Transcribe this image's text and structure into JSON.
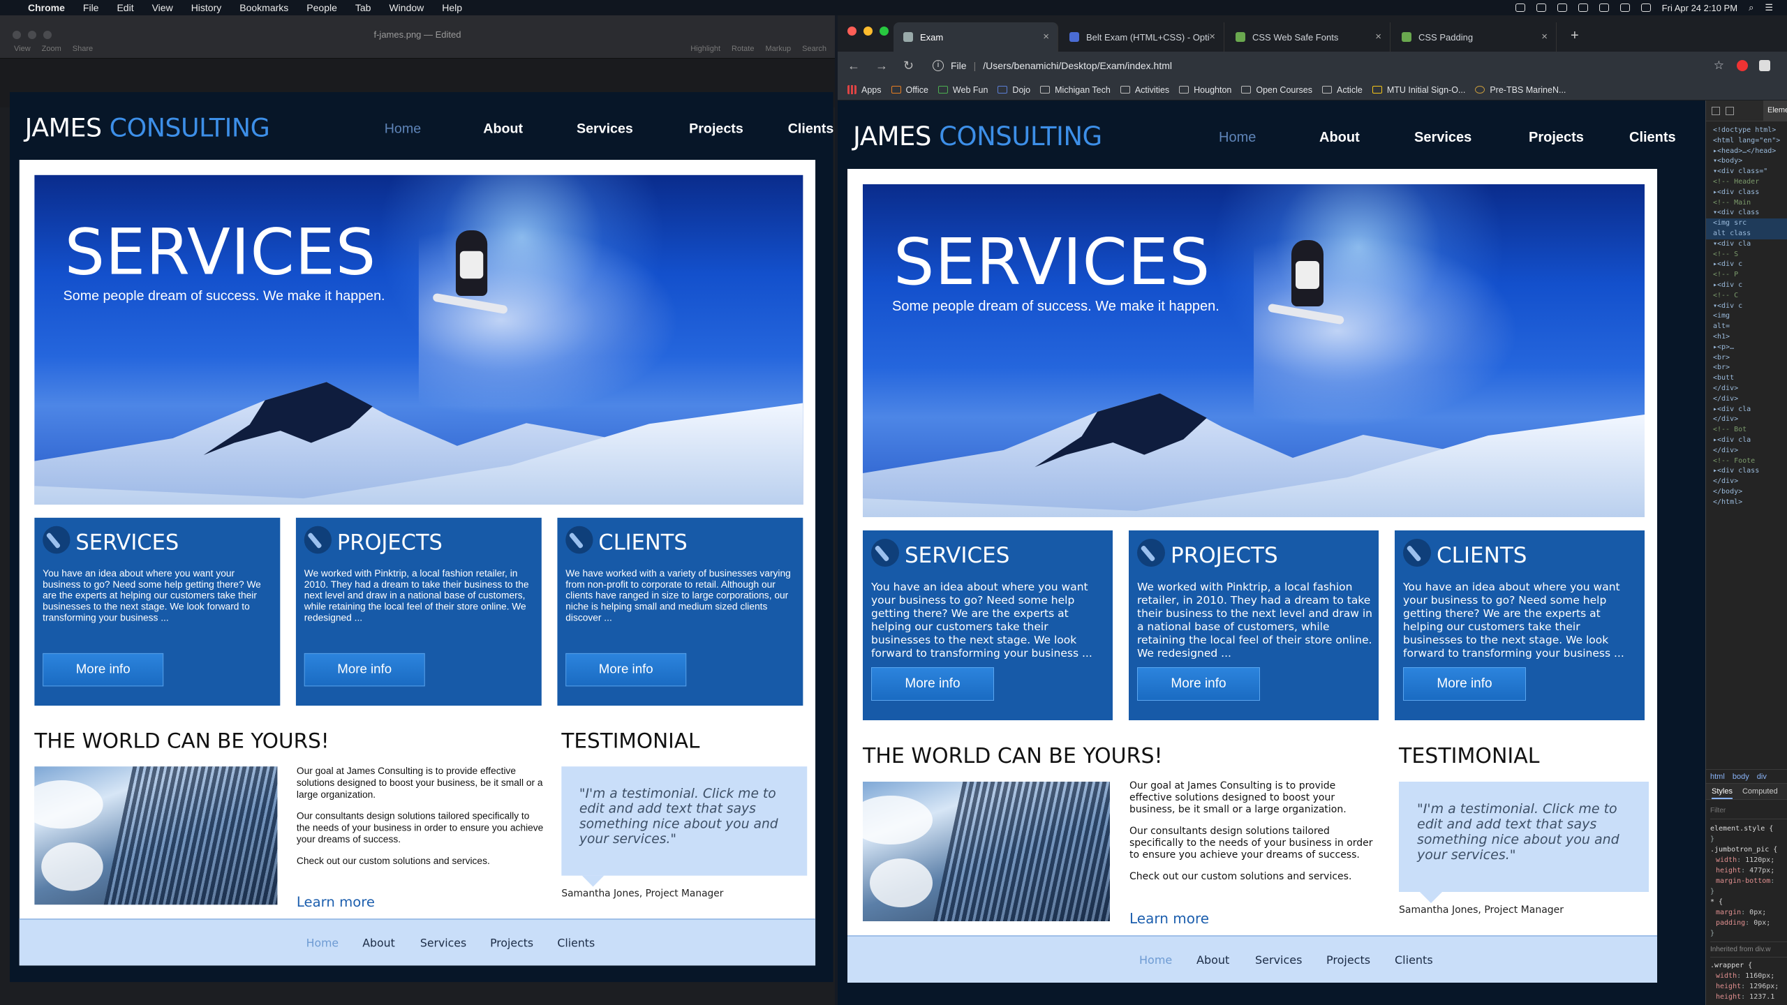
{
  "menubar": {
    "apple": "",
    "app": "Chrome",
    "items": [
      "File",
      "Edit",
      "View",
      "History",
      "Bookmarks",
      "People",
      "Tab",
      "Window",
      "Help"
    ],
    "clock": "Fri Apr 24  2:10 PM"
  },
  "preview": {
    "filename": "f-james.png — Edited",
    "left_tools": [
      "View",
      "Zoom",
      "Share"
    ],
    "right_tools": [
      "Highlight",
      "Rotate",
      "Markup",
      "Search"
    ]
  },
  "chrome": {
    "tabs": [
      {
        "title": "Exam"
      },
      {
        "title": "Belt Exam (HTML+CSS) - Opti"
      },
      {
        "title": "CSS Web Safe Fonts"
      },
      {
        "title": "CSS Padding"
      }
    ],
    "new_tab": "+",
    "url_scheme": "File",
    "url": "/Users/benamichi/Desktop/Exam/index.html",
    "bookmarks": [
      "Apps",
      "Office",
      "Web Fun",
      "Dojo",
      "Michigan Tech",
      "Activities",
      "Houghton",
      "Open Courses",
      "Acticle",
      "MTU Initial Sign-O...",
      "Pre-TBS MarineN..."
    ]
  },
  "devtools": {
    "panel": "Elemen",
    "dom": [
      "<!doctype html>",
      "<html lang=\"en\">",
      "▸<head>…</head>",
      "▾<body>",
      "  ▾<div class=\"",
      "    <!-- Header",
      "  ▸<div class",
      "    <!-- Main",
      "  ▾<div class",
      "     <img src",
      "     alt class",
      "  ▾<div cla",
      "    <!-- S",
      "  ▸<div c",
      "    <!-- P",
      "  ▸<div c",
      "    <!-- C",
      "  ▾<div c",
      "     <img",
      "     alt=",
      "     <h1>",
      "    ▸<p>…",
      "     <br>",
      "     <br>",
      "     <butt",
      "    </div>",
      "   </div>",
      "  ▸<div cla",
      "  </div>",
      "   <!-- Bot",
      "  ▸<div cla",
      "  </div>",
      "  <!-- Foote",
      "  ▸<div class",
      "  </div>",
      " </body>",
      "</html>"
    ],
    "crumbs": [
      "html",
      "body",
      "div"
    ],
    "style_tabs": [
      "Styles",
      "Computed"
    ],
    "filter": "Filter",
    "rules": [
      {
        "sel": "element.style {",
        "decls": [],
        "close": "}"
      },
      {
        "sel": ".jumbotron_pic {",
        "decls": [
          [
            "width",
            "1120px;"
          ],
          [
            "height",
            "477px;"
          ],
          [
            "margin-bottom",
            ""
          ]
        ],
        "close": "}"
      },
      {
        "sel": "* {",
        "decls": [
          [
            "margin",
            "0px;"
          ],
          [
            "padding",
            "0px;"
          ]
        ],
        "close": "}"
      }
    ],
    "inherited": "Inherited from div.w",
    "wrapper": {
      "sel": ".wrapper {",
      "decls": [
        [
          "width",
          "1160px;"
        ],
        [
          "height",
          "1296px;"
        ],
        [
          "height",
          "1237.1"
        ]
      ]
    }
  },
  "site": {
    "logo_main": "JAMES",
    "logo_accent": "CONSULTING",
    "nav": [
      "Home",
      "About",
      "Services",
      "Projects",
      "Clients"
    ],
    "hero_title": "SERVICES",
    "hero_sub": "Some people dream of success. We make it happen.",
    "boxes": [
      {
        "title": "SERVICES",
        "text": "You have an idea about where you want your business to go? Need some help getting there? We are the experts at helping our customers take their businesses to the next stage. We look forward to transforming your business ...",
        "button": "More info"
      },
      {
        "title": "PROJECTS",
        "text": "We worked with Pinktrip, a local fashion retailer, in 2010. They had a dream to take their business to the next level and draw in a national base of customers, while retaining the local feel of their store online. We redesigned ...",
        "button": "More info"
      },
      {
        "title": "CLIENTS",
        "text": "You have an idea about where you want your business to go? Need some help getting there? We are the experts at helping our customers take their businesses to the next stage. We look forward to transforming your business ...",
        "button": "More info"
      }
    ],
    "left_boxes": [
      {
        "title": "SERVICES",
        "text": "You have an idea about where you want your business to go? Need some help getting there? We are the experts at helping our customers take their businesses to the next stage. We look forward to transforming your business ...",
        "button": "More info"
      },
      {
        "title": "PROJECTS",
        "text": "We worked with Pinktrip, a local fashion retailer, in 2010. They had a dream to take their business to the next level and draw in a national base of customers, while retaining the local feel of their store online. We redesigned ...",
        "button": "More info"
      },
      {
        "title": "CLIENTS",
        "text": "We have worked with a variety of businesses varying from non-profit to corporate to retail. Although our clients have ranged in size to large corporations, our niche is helping small and medium sized clients discover ...",
        "button": "More info"
      }
    ],
    "world_title": "THE WORLD CAN BE YOURS!",
    "goal": [
      "Our goal at James Consulting is to provide effective solutions designed to boost your business, be it small or a large organization.",
      "Our consultants design solutions tailored specifically to the needs of your business in order to ensure you achieve your dreams of success.",
      "Check out our custom solutions and services."
    ],
    "learn_more": "Learn more",
    "testimonial_title": "TESTIMONIAL",
    "quote": "\"I'm a testimonial. Click me to edit and add text that says something nice about you and your services.\"",
    "author": "Samantha Jones, Project Manager",
    "footer": [
      "Home",
      "About",
      "Services",
      "Projects",
      "Clients"
    ]
  },
  "colors": {
    "site_bg": "#071628",
    "accent": "#3d8fe8",
    "box_bg": "#175aa8",
    "footer_bg": "#c9def9"
  }
}
